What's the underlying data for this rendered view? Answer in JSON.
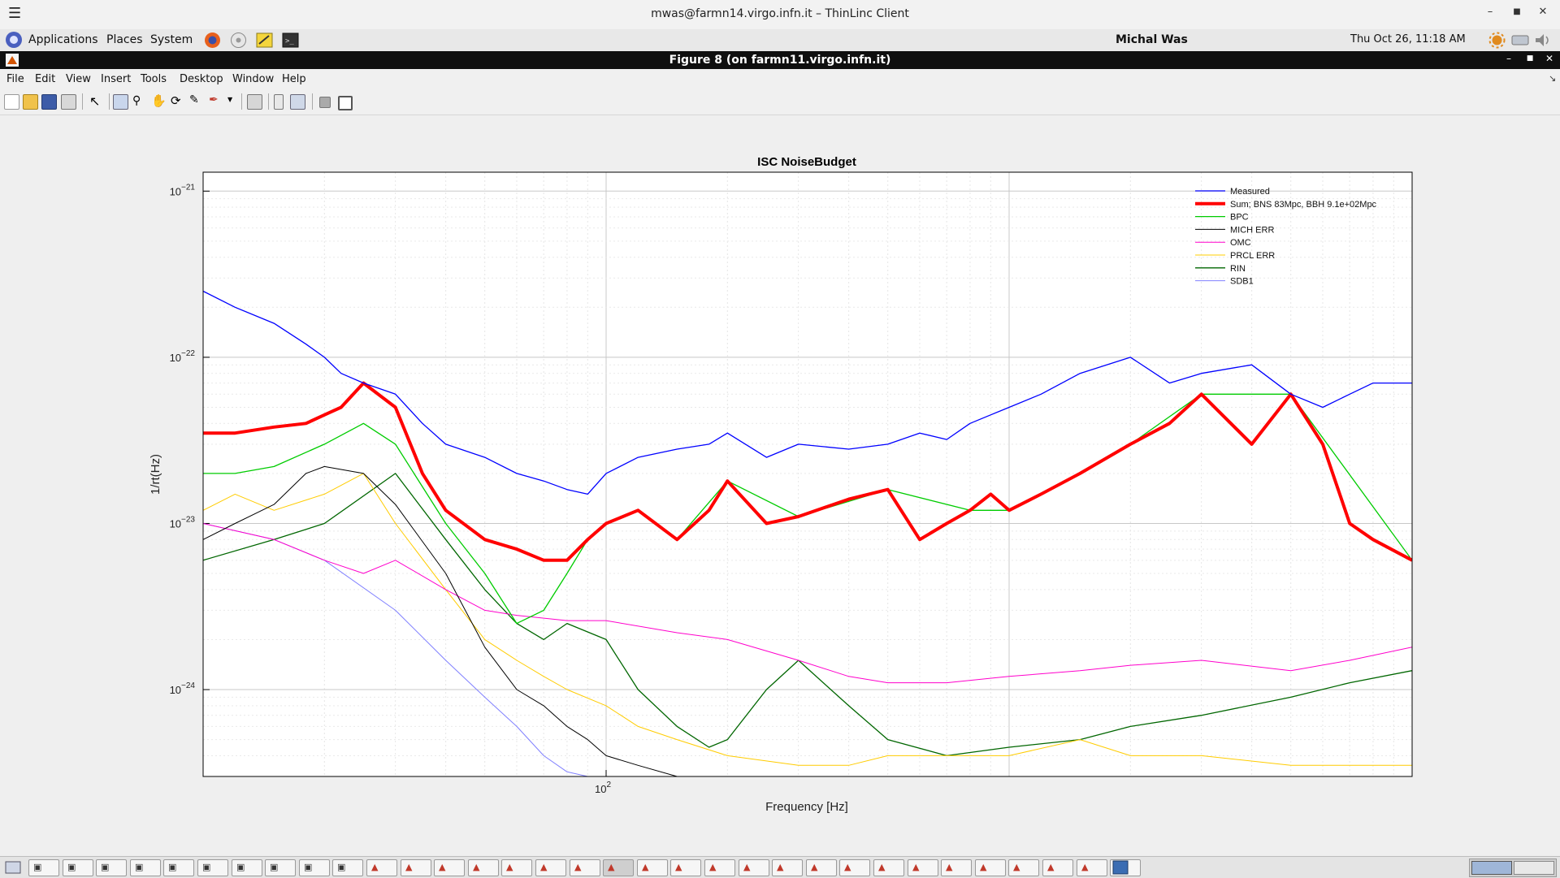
{
  "window": {
    "title": "mwas@farmn14.virgo.infn.it – ThinLinc Client"
  },
  "panel": {
    "applications": "Applications",
    "places": "Places",
    "system": "System",
    "user": "Michal Was",
    "clock": "Thu Oct 26, 11:18 AM"
  },
  "figure_window": {
    "title": "Figure 8 (on farmn11.virgo.infn.it)"
  },
  "menu": [
    "File",
    "Edit",
    "View",
    "Insert",
    "Tools",
    "Desktop",
    "Window",
    "Help"
  ],
  "colors": {
    "measured": "#0000ff",
    "sum": "#ff0000",
    "bpc": "#00cc00",
    "mich_err": "#000000",
    "omc": "#ff00cc",
    "prcl_err": "#ffcc00",
    "rin": "#006600",
    "sdb1": "#8080ff"
  },
  "chart_data": {
    "type": "line",
    "title": "ISC NoiseBudget",
    "xlabel": "Frequency [Hz]",
    "ylabel": "1/rt(Hz)",
    "xscale": "log",
    "yscale": "log",
    "xlim": [
      10,
      10000
    ],
    "ylim": [
      3e-25,
      1.3e-21
    ],
    "xticks": [
      {
        "value": 100,
        "base": "10",
        "exp": "2"
      }
    ],
    "yticks": [
      {
        "value": 1e-21,
        "base": "10",
        "exp": "−21"
      },
      {
        "value": 1e-22,
        "base": "10",
        "exp": "−22"
      },
      {
        "value": 1e-23,
        "base": "10",
        "exp": "−23"
      },
      {
        "value": 1e-24,
        "base": "10",
        "exp": "−24"
      }
    ],
    "grid": true,
    "legend_position": "top-right",
    "legend": [
      "Measured",
      "Sum; BNS 83Mpc, BBH 9.1e+02Mpc",
      "BPC",
      "MICH ERR",
      "OMC",
      "PRCL ERR",
      "RIN",
      "SDB1"
    ],
    "series": [
      {
        "name": "Measured",
        "key": "measured",
        "width": 1.3,
        "x": [
          10,
          12,
          15,
          18,
          20,
          22,
          25,
          30,
          35,
          40,
          50,
          60,
          70,
          80,
          90,
          100,
          120,
          150,
          180,
          200,
          250,
          300,
          400,
          500,
          600,
          700,
          800,
          900,
          1000,
          1200,
          1500,
          2000,
          2500,
          3000,
          4000,
          5000,
          6000,
          7000,
          8000,
          10000
        ],
        "y": [
          2.5e-22,
          2e-22,
          1.6e-22,
          1.2e-22,
          1e-22,
          8e-23,
          7e-23,
          6e-23,
          4e-23,
          3e-23,
          2.5e-23,
          2e-23,
          1.8e-23,
          1.6e-23,
          1.5e-23,
          2e-23,
          2.5e-23,
          2.8e-23,
          3e-23,
          3.5e-23,
          2.5e-23,
          3e-23,
          2.8e-23,
          3e-23,
          3.5e-23,
          3.2e-23,
          4e-23,
          4.5e-23,
          5e-23,
          6e-23,
          8e-23,
          1e-22,
          7e-23,
          8e-23,
          9e-23,
          6e-23,
          5e-23,
          6e-23,
          7e-23,
          7e-23
        ]
      },
      {
        "name": "Sum; BNS 83Mpc, BBH 9.1e+02Mpc",
        "key": "sum",
        "width": 4,
        "x": [
          10,
          12,
          15,
          18,
          20,
          22,
          25,
          30,
          35,
          40,
          50,
          60,
          70,
          80,
          90,
          100,
          120,
          150,
          180,
          200,
          250,
          300,
          400,
          500,
          600,
          700,
          800,
          900,
          1000,
          1200,
          1500,
          2000,
          2500,
          3000,
          4000,
          5000,
          6000,
          7000,
          8000,
          10000
        ],
        "y": [
          3.5e-23,
          3.5e-23,
          3.8e-23,
          4e-23,
          4.5e-23,
          5e-23,
          7e-23,
          5e-23,
          2e-23,
          1.2e-23,
          8e-24,
          7e-24,
          6e-24,
          6e-24,
          8e-24,
          1e-23,
          1.2e-23,
          8e-24,
          1.2e-23,
          1.8e-23,
          1e-23,
          1.1e-23,
          1.4e-23,
          1.6e-23,
          8e-24,
          1e-23,
          1.2e-23,
          1.5e-23,
          1.2e-23,
          1.5e-23,
          2e-23,
          3e-23,
          4e-23,
          6e-23,
          3e-23,
          6e-23,
          3e-23,
          1e-23,
          8e-24,
          6e-24
        ]
      },
      {
        "name": "BPC",
        "key": "bpc",
        "width": 1.3,
        "x": [
          10,
          12,
          15,
          20,
          25,
          30,
          40,
          50,
          60,
          70,
          80,
          90,
          100,
          120,
          150,
          200,
          300,
          500,
          800,
          1000,
          1500,
          2000,
          3000,
          5000,
          10000
        ],
        "y": [
          2e-23,
          2e-23,
          2.2e-23,
          3e-23,
          4e-23,
          3e-23,
          1e-23,
          5e-24,
          2.5e-24,
          3e-24,
          5e-24,
          8e-24,
          1e-23,
          1.2e-23,
          8e-24,
          1.8e-23,
          1.1e-23,
          1.6e-23,
          1.2e-23,
          1.2e-23,
          2e-23,
          3e-23,
          6e-23,
          6e-23,
          6e-24
        ]
      },
      {
        "name": "MICH ERR",
        "key": "mich_err",
        "width": 1,
        "x": [
          10,
          12,
          15,
          18,
          20,
          25,
          30,
          40,
          50,
          60,
          70,
          80,
          90,
          100,
          120,
          150,
          180
        ],
        "y": [
          8e-24,
          1e-23,
          1.3e-23,
          2e-23,
          2.2e-23,
          2e-23,
          1.3e-23,
          5e-24,
          1.8e-24,
          1e-24,
          8e-25,
          6e-25,
          5e-25,
          4e-25,
          3.5e-25,
          3e-25,
          3e-25
        ]
      },
      {
        "name": "OMC",
        "key": "omc",
        "width": 1,
        "x": [
          10,
          15,
          20,
          25,
          30,
          40,
          50,
          60,
          80,
          100,
          150,
          200,
          300,
          400,
          500,
          700,
          1000,
          1500,
          2000,
          3000,
          5000,
          7000,
          10000
        ],
        "y": [
          1e-23,
          8e-24,
          6e-24,
          5e-24,
          6e-24,
          4e-24,
          3e-24,
          2.8e-24,
          2.6e-24,
          2.6e-24,
          2.2e-24,
          2e-24,
          1.5e-24,
          1.2e-24,
          1.1e-24,
          1.1e-24,
          1.2e-24,
          1.3e-24,
          1.4e-24,
          1.5e-24,
          1.3e-24,
          1.5e-24,
          1.8e-24
        ]
      },
      {
        "name": "PRCL ERR",
        "key": "prcl_err",
        "width": 1,
        "x": [
          10,
          12,
          15,
          20,
          25,
          30,
          40,
          50,
          60,
          70,
          80,
          100,
          120,
          150,
          200,
          300,
          400,
          500,
          700,
          1000,
          1500,
          2000,
          3000,
          5000,
          10000
        ],
        "y": [
          1.2e-23,
          1.5e-23,
          1.2e-23,
          1.5e-23,
          2e-23,
          1e-23,
          4e-24,
          2e-24,
          1.5e-24,
          1.2e-24,
          1e-24,
          8e-25,
          6e-25,
          5e-25,
          4e-25,
          3.5e-25,
          3.5e-25,
          4e-25,
          4e-25,
          4e-25,
          5e-25,
          4e-25,
          4e-25,
          3.5e-25,
          3.5e-25
        ]
      },
      {
        "name": "RIN",
        "key": "rin",
        "width": 1.3,
        "x": [
          10,
          15,
          20,
          30,
          40,
          50,
          60,
          70,
          80,
          100,
          120,
          150,
          180,
          200,
          250,
          300,
          400,
          500,
          700,
          1000,
          1500,
          2000,
          3000,
          5000,
          7000,
          10000
        ],
        "y": [
          6e-24,
          8e-24,
          1e-23,
          2e-23,
          8e-24,
          4e-24,
          2.5e-24,
          2e-24,
          2.5e-24,
          2e-24,
          1e-24,
          6e-25,
          4.5e-25,
          5e-25,
          1e-24,
          1.5e-24,
          8e-25,
          5e-25,
          4e-25,
          4.5e-25,
          5e-25,
          6e-25,
          7e-25,
          9e-25,
          1.1e-24,
          1.3e-24
        ]
      },
      {
        "name": "SDB1",
        "key": "sdb1",
        "width": 1,
        "x": [
          10,
          15,
          20,
          30,
          40,
          50,
          60,
          70,
          80,
          90,
          100
        ],
        "y": [
          1e-23,
          8e-24,
          6e-24,
          3e-24,
          1.5e-24,
          9e-25,
          6e-25,
          4e-25,
          3.2e-25,
          3e-25,
          3e-25
        ]
      }
    ]
  }
}
